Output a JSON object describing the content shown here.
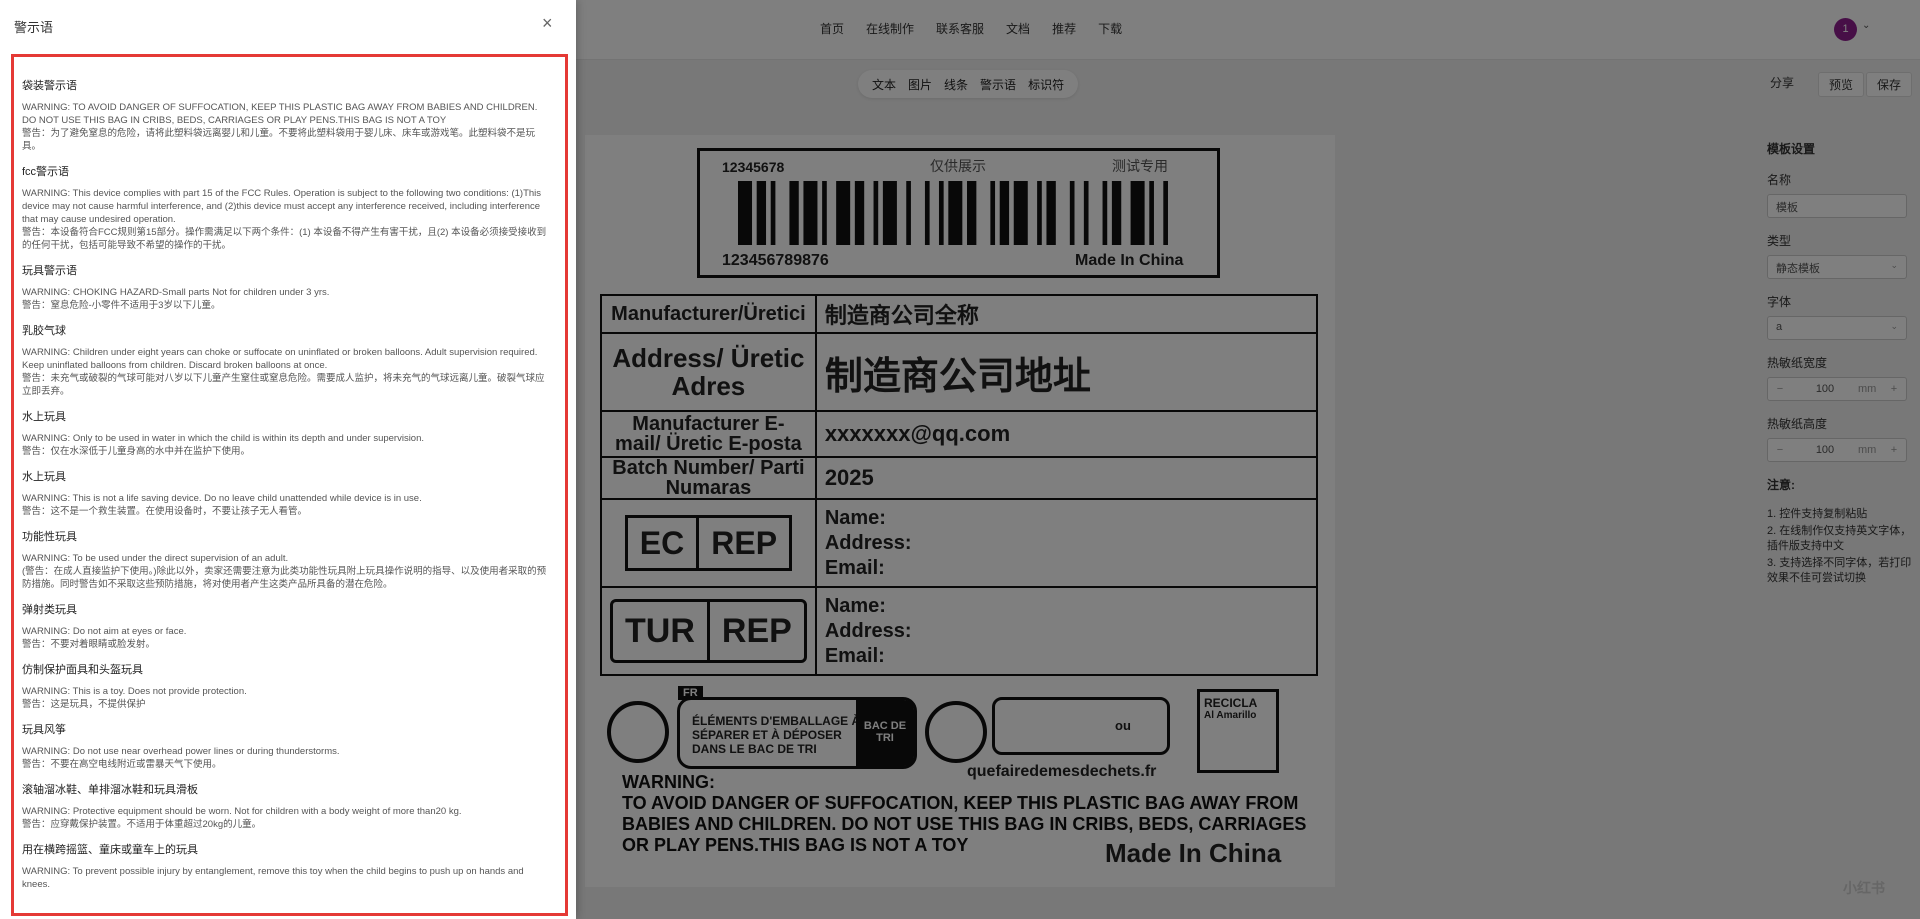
{
  "nav": {
    "links": [
      "首页",
      "在线制作",
      "联系客服",
      "文档",
      "推荐",
      "下载"
    ],
    "avatar": "1",
    "avatar_caret": "⌄"
  },
  "toolbar": {
    "items": [
      "文本",
      "图片",
      "线条",
      "警示语",
      "标识符"
    ]
  },
  "actions": {
    "share": "分享",
    "preview": "预览",
    "save": "保存"
  },
  "label": {
    "barcode_top": "12345678",
    "only_show": "仅供展示",
    "test": "测试专用",
    "barcode_bottom": "123456789876",
    "made_in": "Made In China",
    "rows": [
      {
        "k": "Manufacturer/Üretici",
        "v": "制造商公司全称"
      },
      {
        "k": "Address/ Üretic Adres",
        "v": "制造商公司地址"
      },
      {
        "k": "Manufacturer E-mail/ Üretic E-posta",
        "v": "xxxxxxx@qq.com"
      },
      {
        "k": "Batch Number/ Parti Numaras",
        "v": "2025"
      }
    ],
    "ec_rep": [
      "EC",
      "REP"
    ],
    "tur_rep": [
      "TUR",
      "REP"
    ],
    "contact": {
      "name": "Name:",
      "address": "Address:",
      "email": "Email:"
    },
    "fr_tag": "FR",
    "fr_text": "ÉLÉMENTS D'EMBALLAGE À SÉPARER ET À DÉPOSER DANS LE BAC DE TRI",
    "bac": "BAC DE TRI",
    "ou": "ou",
    "url": "quefairedemesdechets.fr",
    "recicla_1": "RECICLA",
    "recicla_2": "Al Amarillo",
    "warning_head": "WARNING:",
    "warning_text": "TO AVOID DANGER OF SUFFOCATION, KEEP THIS PLASTIC BAG AWAY FROM BABIES AND CHILDREN. DO NOT USE THIS BAG IN CRIBS, BEDS, CARRIAGES OR PLAY PENS.THIS BAG IS NOT A TOY",
    "made_big": "Made In China"
  },
  "rightpanel": {
    "title": "模板设置",
    "name_label": "名称",
    "name_value": "模板",
    "type_label": "类型",
    "type_value": "静态模板",
    "font_label": "字体",
    "font_value": "a",
    "width_label": "热敏纸宽度",
    "width_value": "100",
    "height_label": "热敏纸高度",
    "height_value": "100",
    "unit": "mm",
    "minus": "−",
    "plus": "+",
    "note_title": "注意:",
    "notes": [
      "1. 控件支持复制粘贴",
      "2. 在线制作仅支持英文字体，插件版支持中文",
      "3. 支持选择不同字体，若打印效果不佳可尝试切换"
    ]
  },
  "watermark": "小红书",
  "drawer": {
    "title": "警示语",
    "close": "×",
    "sections": [
      {
        "title": "袋装警示语",
        "en": "WARNING: TO AVOID DANGER OF SUFFOCATION, KEEP THIS PLASTIC BAG AWAY FROM BABIES AND CHILDREN. DO NOT USE THIS BAG IN CRIBS, BEDS, CARRIAGES OR PLAY PENS.THIS BAG IS NOT A TOY",
        "cn": "警告：为了避免窒息的危险，请将此塑料袋远离婴儿和儿童。不要将此塑料袋用于婴儿床、床车或游戏笔。此塑料袋不是玩具。"
      },
      {
        "title": "fcc警示语",
        "en": "WARNING: This device complies with part 15 of the FCC Rules. Operation is subject to the following two conditions: (1)This device may not cause harmful interference, and (2)this device must accept any interference received, including interference that may cause undesired operation.",
        "cn": "警告：本设备符合FCC规则第15部分。操作需满足以下两个条件：(1) 本设备不得产生有害干扰，且(2) 本设备必须接受接收到的任何干扰，包括可能导致不希望的操作的干扰。"
      },
      {
        "title": "玩具警示语",
        "en": "WARNING: CHOKING HAZARD-Small parts Not for children under 3 yrs.",
        "cn": "警告：窒息危险-小零件不适用于3岁以下儿童。"
      },
      {
        "title": "乳胶气球",
        "en": "WARNING: Children under eight years can choke or suffocate on uninflated or broken balloons. Adult supervision required. Keep uninflated balloons from children. Discard broken balloons at once.",
        "cn": "警告：未充气或破裂的气球可能对八岁以下儿童产生窒住或窒息危险。需要成人监护，将未充气的气球远离儿童。破裂气球应立即丢弃。"
      },
      {
        "title": "水上玩具",
        "en": "WARNING: Only to be used in water in which the child is within its depth and under supervision.",
        "cn": "警告：仅在水深低于儿童身高的水中并在监护下使用。"
      },
      {
        "title": "水上玩具",
        "en": "WARNING: This is not a life saving device. Do no leave child unattended while device is in use.",
        "cn": "警告：这不是一个救生装置。在使用设备时，不要让孩子无人看管。"
      },
      {
        "title": "功能性玩具",
        "en": "WARNING: To be used under the direct supervision of an adult.",
        "cn": "(警告：在成人直接监护下使用。)除此以外，卖家还需要注意为此类功能性玩具附上玩具操作说明的指导、以及使用者采取的预防措施。同时警告如不采取这些预防措施，将对使用者产生这类产品所具备的潜在危险。"
      },
      {
        "title": "弹射类玩具",
        "en": "WARNING: Do not aim at eyes or face.",
        "cn": "警告：不要对着眼睛或脸发射。"
      },
      {
        "title": "仿制保护面具和头盔玩具",
        "en": "WARNING: This is a toy. Does not provide protection.",
        "cn": "警告：这是玩具，不提供保护"
      },
      {
        "title": "玩具风筝",
        "en": "WARNING: Do not use near overhead power lines or during thunderstorms.",
        "cn": "警告：不要在高空电线附近或雷暴天气下使用。"
      },
      {
        "title": "滚轴溜冰鞋、单排溜冰鞋和玩具滑板",
        "en": "WARNING: Protective equipment should be worn. Not for children with a body weight of more than20 kg.",
        "cn": "警告：应穿戴保护装置。不适用于体重超过20kg的儿童。"
      },
      {
        "title": "用在横跨摇篮、童床或童车上的玩具",
        "en": "WARNING: To prevent possible injury by entanglement, remove this toy when the child begins to push up on hands and knees.",
        "cn": ""
      }
    ]
  }
}
